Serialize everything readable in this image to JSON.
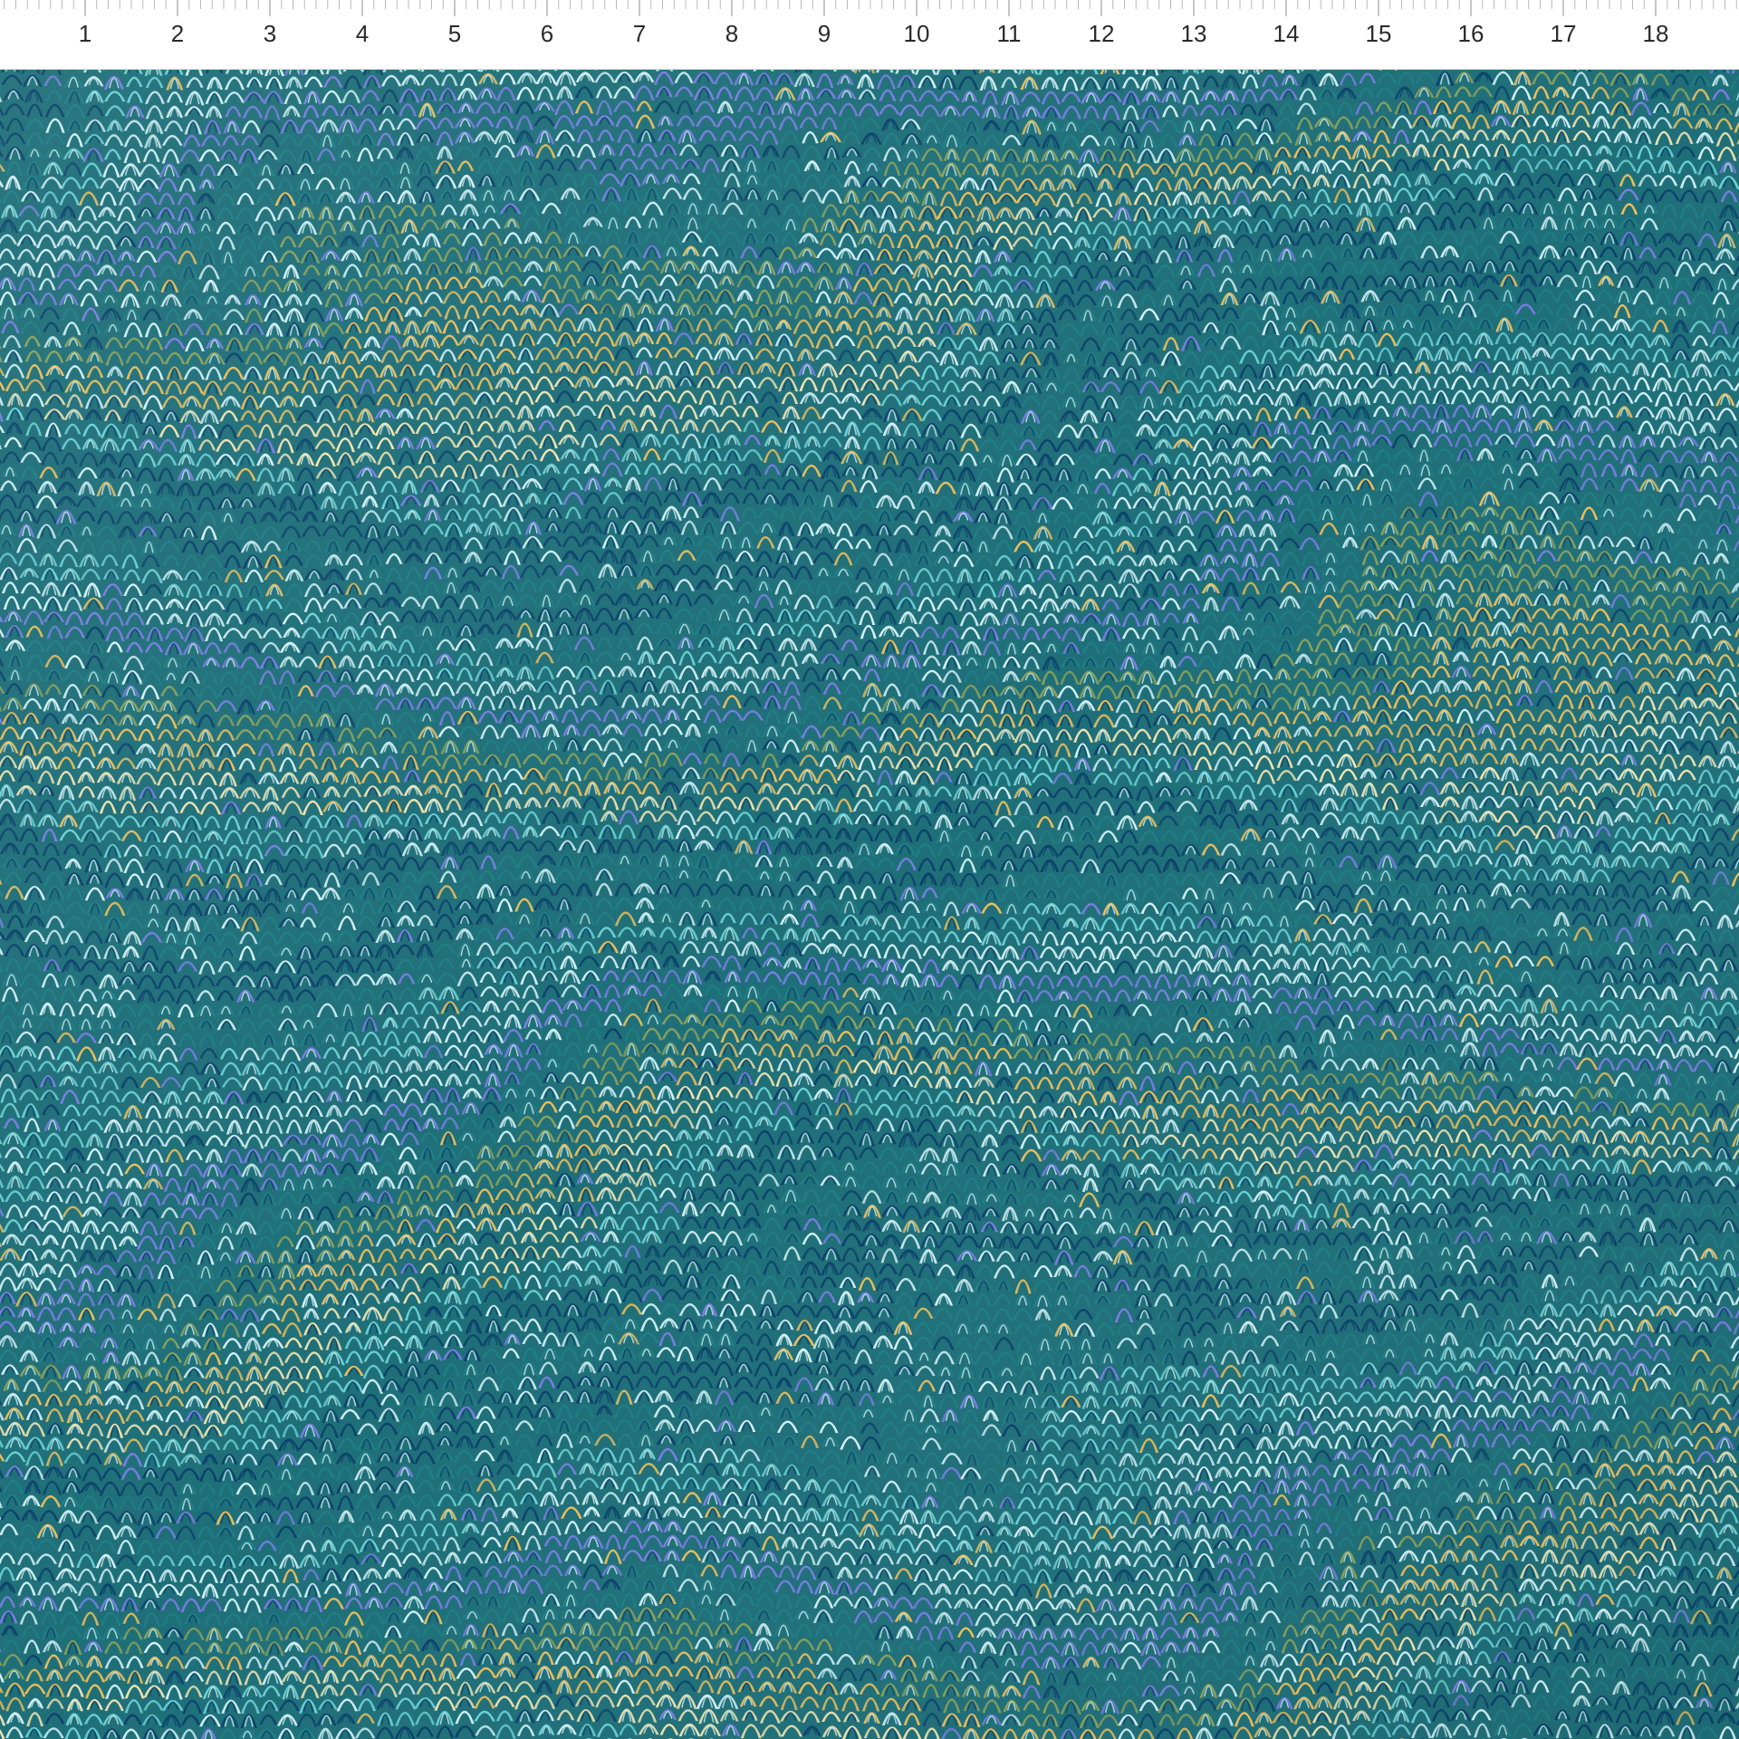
{
  "ruler": {
    "labels": [
      "1",
      "2",
      "3",
      "4",
      "5",
      "6",
      "7",
      "8",
      "9",
      "10",
      "11",
      "12",
      "13",
      "14",
      "15",
      "16",
      "17",
      "18"
    ]
  },
  "fabric": {
    "pattern": "marbled-nonpareil-wave",
    "palette": {
      "deep_navy": "#0b3f6a",
      "teal": "#1f7f86",
      "aqua": "#6ed5d7",
      "ice": "#d9f6fa",
      "periwinkle": "#7c7ee6",
      "olive": "#8ea35a",
      "gold": "#f2c15a",
      "cream": "#f7e7b1"
    }
  }
}
